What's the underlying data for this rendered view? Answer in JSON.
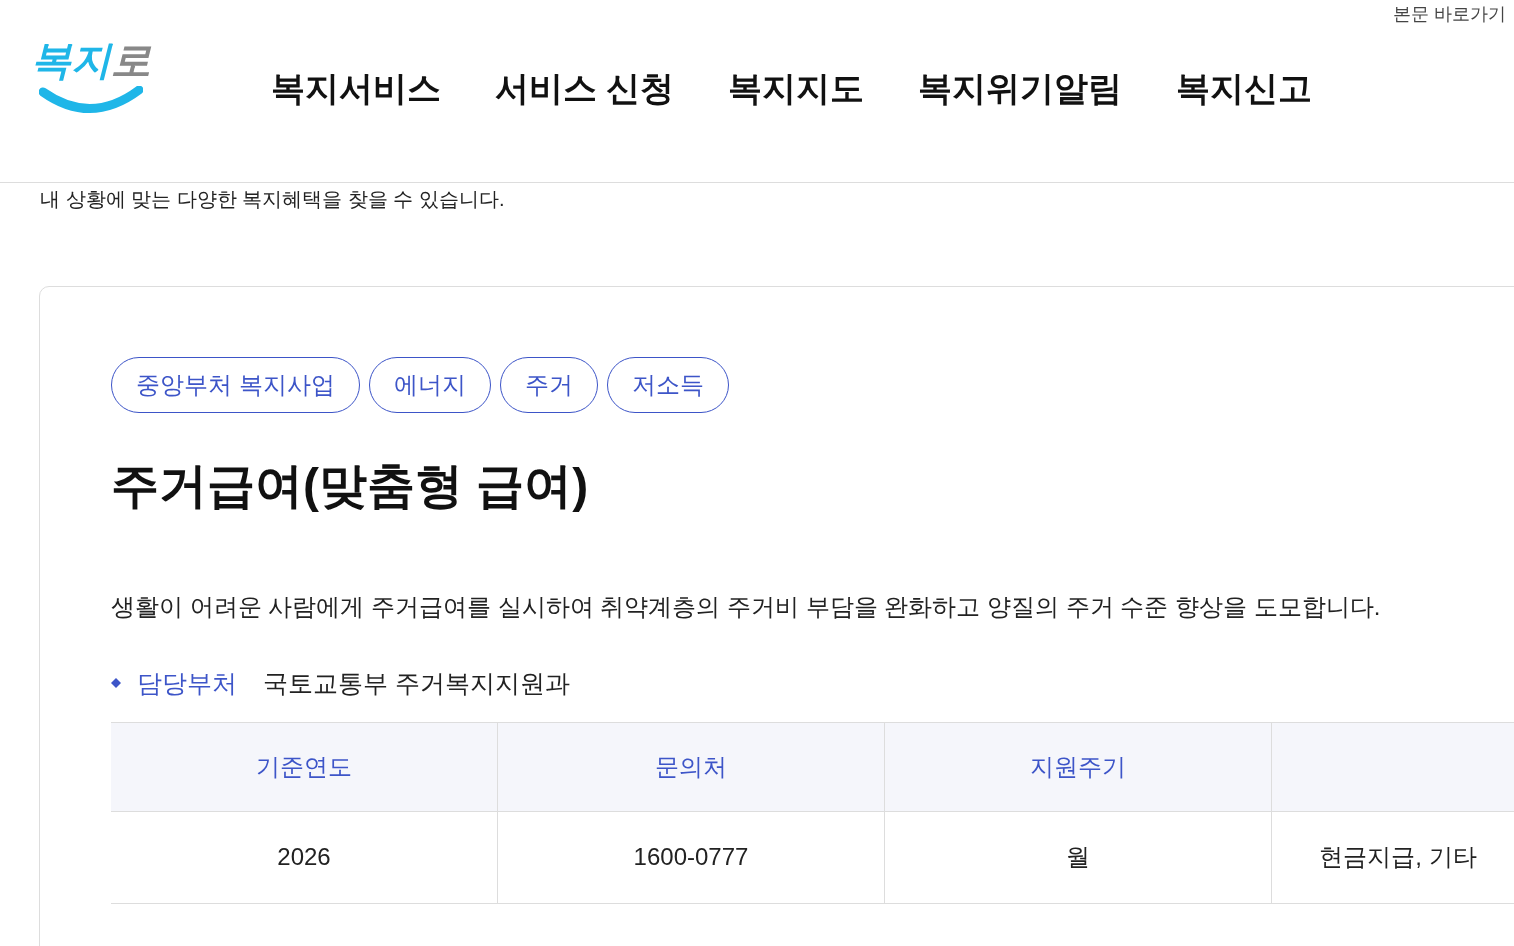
{
  "skip_link": "본문 바로가기",
  "logo": {
    "text": "복지",
    "suffix": "로"
  },
  "nav": [
    "복지서비스",
    "서비스 신청",
    "복지지도",
    "복지위기알림",
    "복지신고"
  ],
  "intro": "내 상황에 맞는 다양한 복지혜택을 찾을 수 있습니다.",
  "tags": [
    "중앙부처 복지사업",
    "에너지",
    "주거",
    "저소득"
  ],
  "title": "주거급여(맞춤형 급여)",
  "description": "생활이 어려운 사람에게 주거급여를 실시하여 취약계층의 주거비 부담을 완화하고 양질의 주거 수준 향상을 도모합니다.",
  "department": {
    "label": "담당부처",
    "value": "국토교통부 주거복지지원과"
  },
  "table": {
    "columns": [
      "기준연도",
      "문의처",
      "지원주기"
    ],
    "rows": [
      [
        "2026",
        "1600-0777",
        "월",
        "현금지급, 기타"
      ]
    ]
  }
}
